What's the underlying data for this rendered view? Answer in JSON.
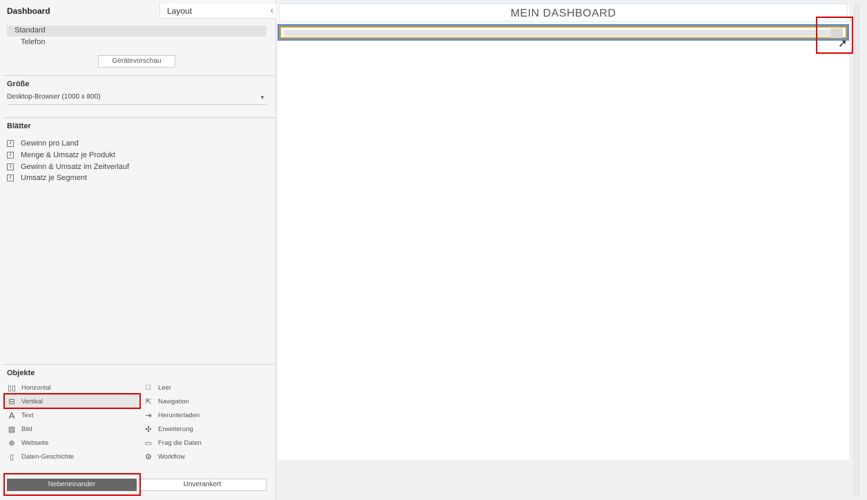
{
  "panel": {
    "tab_dashboard": "Dashboard",
    "tab_layout": "Layout",
    "collapse_icon": "chevron-left-icon",
    "devices": [
      "Standard",
      "Telefon"
    ],
    "device_preview": "Gerätevorschau"
  },
  "size": {
    "heading": "Größe",
    "value": "Desktop-Browser (1000 x 800)"
  },
  "sheets": {
    "heading": "Blätter",
    "items": [
      "Gewinn pro Land",
      "Menge & Umsatz je Produkt",
      "Gewinn & Umsatz im Zeitverlauf",
      "Umsatz je Segment"
    ]
  },
  "objects": {
    "heading": "Objekte",
    "left": [
      {
        "label": "Horizontal",
        "icon": "horizontal-icon"
      },
      {
        "label": "Vertikal",
        "icon": "vertical-icon"
      },
      {
        "label": "Text",
        "icon": "text-icon"
      },
      {
        "label": "Bild",
        "icon": "image-icon"
      },
      {
        "label": "Webseite",
        "icon": "globe-icon"
      },
      {
        "label": "Daten-Geschichte",
        "icon": "book-icon"
      }
    ],
    "right": [
      {
        "label": "Leer",
        "icon": "blank-icon"
      },
      {
        "label": "Navigation",
        "icon": "navigation-icon"
      },
      {
        "label": "Herunterladen",
        "icon": "download-icon"
      },
      {
        "label": "Erweiterung",
        "icon": "puzzle-icon"
      },
      {
        "label": "Frag die Daten",
        "icon": "ask-data-icon"
      },
      {
        "label": "Workflow",
        "icon": "workflow-icon"
      }
    ]
  },
  "placement": {
    "tiled": "Nebeneinander",
    "floating": "Unverankert"
  },
  "dashboard": {
    "title": "MEIN DASHBOARD"
  }
}
